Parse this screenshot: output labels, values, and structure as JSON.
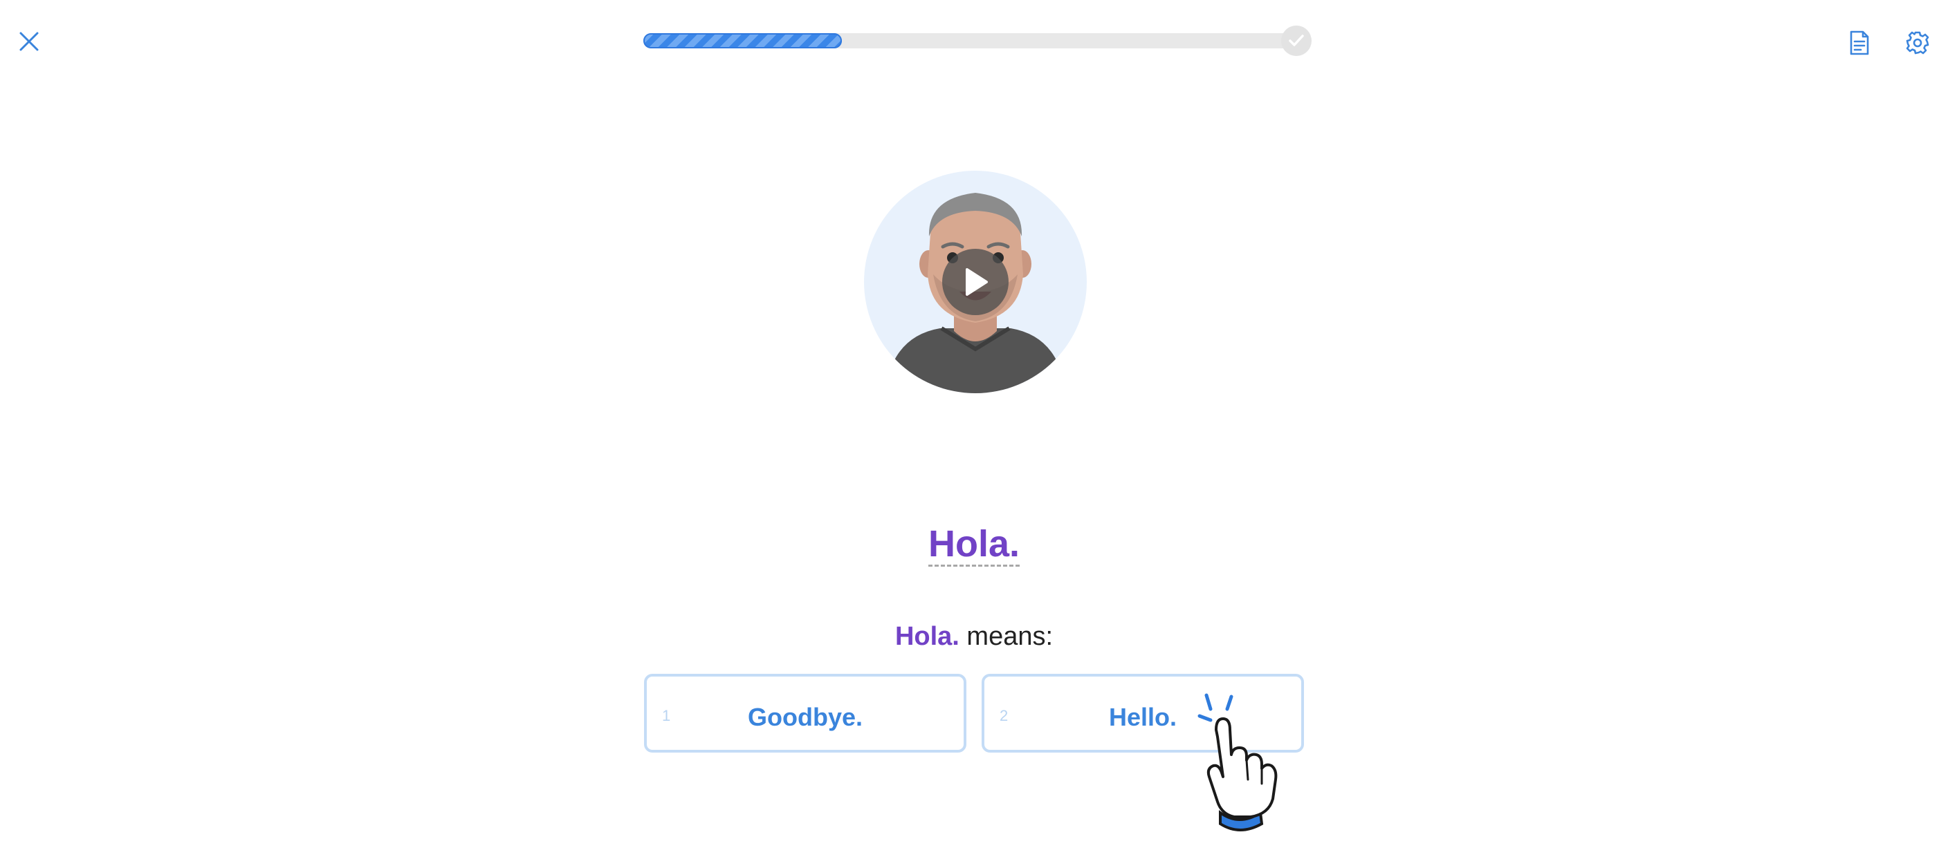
{
  "progress": {
    "value": 0.3
  },
  "lesson": {
    "word": "Hola.",
    "prompt_word": "Hola.",
    "prompt_suffix": "means:"
  },
  "options": [
    {
      "number": "1",
      "label": "Goodbye."
    },
    {
      "number": "2",
      "label": "Hello."
    }
  ],
  "colors": {
    "accent_blue": "#3a84dc",
    "word_purple": "#7142c6",
    "option_border": "#c4dcf6"
  },
  "icons": {
    "close": "close-icon",
    "notes": "notes-icon",
    "settings": "gear-icon",
    "play": "play-icon",
    "check": "checkmark-icon",
    "hand": "pointer-hand-icon"
  }
}
